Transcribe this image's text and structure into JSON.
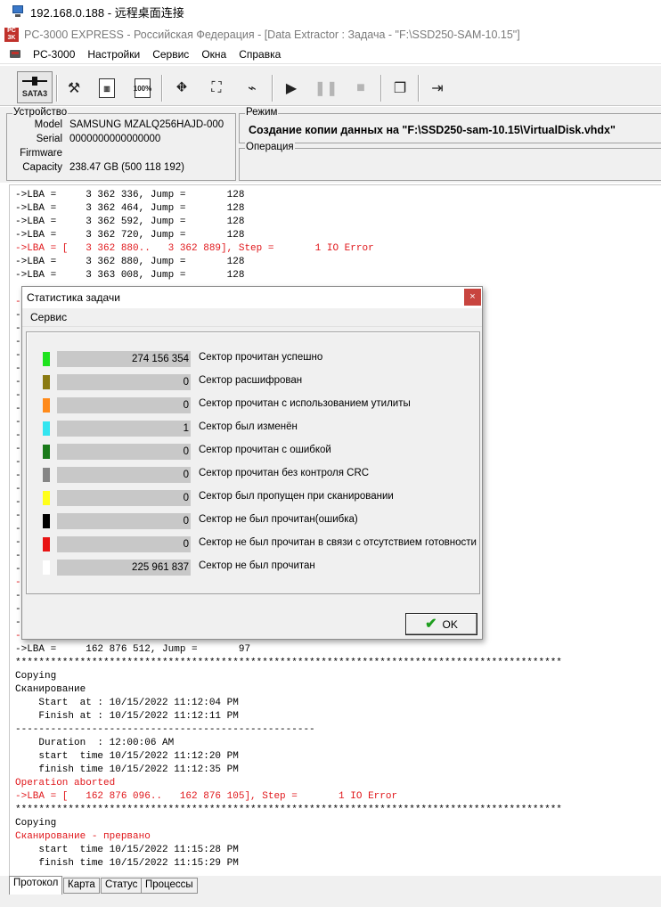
{
  "rdp": {
    "title": "192.168.0.188 - 远程桌面连接"
  },
  "app": {
    "logo": "PC 3K",
    "title": "PC-3000 EXPRESS - Российская Федерация - [Data Extractor : Задача - \"F:\\SSD250-SAM-10.15\"]"
  },
  "menu": {
    "items": [
      "PC-3000",
      "Настройки",
      "Сервис",
      "Окна",
      "Справка"
    ]
  },
  "toolbar": {
    "sata_label": "SATA3",
    "buttons": [
      {
        "name": "tools-icon",
        "glyph": "⚒"
      },
      {
        "name": "memory-icon",
        "glyph": "▥"
      },
      {
        "name": "percent-doc-icon",
        "glyph": "100%"
      },
      {
        "name": "pipe-icon",
        "glyph": "⛖"
      },
      {
        "name": "binoculars-icon",
        "glyph": "⛶"
      },
      {
        "name": "map-icon",
        "glyph": "⌁"
      },
      {
        "name": "play-icon",
        "glyph": "▶"
      },
      {
        "name": "pause-icon",
        "glyph": "❚❚"
      },
      {
        "name": "stop-icon",
        "glyph": "■"
      },
      {
        "name": "windows-icon",
        "glyph": "❐"
      },
      {
        "name": "exit-icon",
        "glyph": "⇥"
      }
    ]
  },
  "device": {
    "group_title": "Устройство",
    "rows": [
      {
        "key": "Model",
        "value": "SAMSUNG MZALQ256HAJD-000"
      },
      {
        "key": "Serial",
        "value": "0000000000000000"
      },
      {
        "key": "Firmware",
        "value": ""
      },
      {
        "key": "Capacity",
        "value": "238.47 GB (500 118 192)"
      }
    ]
  },
  "mode": {
    "group_title": "Режим",
    "text": "Создание копии данных на \"F:\\SSD250-sam-10.15\\VirtualDisk.vhdx\"",
    "operation_title": "Операция"
  },
  "log": {
    "lines": [
      {
        "t": "->LBA =     3 362 336, Jump =       128",
        "c": "black"
      },
      {
        "t": "->LBA =     3 362 464, Jump =       128",
        "c": "black"
      },
      {
        "t": "->LBA =     3 362 592, Jump =       128",
        "c": "black"
      },
      {
        "t": "->LBA =     3 362 720, Jump =       128",
        "c": "black"
      },
      {
        "t": "->LBA = [   3 362 880..   3 362 889], Step =       1 IO Error",
        "c": "red"
      },
      {
        "t": "->LBA =     3 362 880, Jump =       128",
        "c": "black"
      },
      {
        "t": "->LBA =     3 363 008, Jump =       128",
        "c": "black"
      }
    ],
    "lines_bottom": [
      {
        "t": "->LBA =     162 876 512, Jump =       97",
        "c": "black"
      },
      {
        "t": "*********************************************************************************************",
        "c": "black"
      },
      {
        "t": "Copying",
        "c": "black"
      },
      {
        "t": "Сканирование",
        "c": "black"
      },
      {
        "t": "    Start  at : 10/15/2022 11:12:04 PM",
        "c": "black"
      },
      {
        "t": "    Finish at : 10/15/2022 11:12:11 PM",
        "c": "black"
      },
      {
        "t": "---------------------------------------------------",
        "c": "black"
      },
      {
        "t": "    Duration  : 12:00:06 AM",
        "c": "black"
      },
      {
        "t": "    start  time 10/15/2022 11:12:20 PM",
        "c": "black"
      },
      {
        "t": "    finish time 10/15/2022 11:12:35 PM",
        "c": "black"
      },
      {
        "t": "Operation aborted",
        "c": "red"
      },
      {
        "t": "->LBA = [   162 876 096..   162 876 105], Step =       1 IO Error",
        "c": "red"
      },
      {
        "t": "*********************************************************************************************",
        "c": "black"
      },
      {
        "t": "Copying",
        "c": "black"
      },
      {
        "t": "Сканирование - прервано",
        "c": "red"
      },
      {
        "t": "    start  time 10/15/2022 11:15:28 PM",
        "c": "black"
      },
      {
        "t": "    finish time 10/15/2022 11:15:29 PM",
        "c": "black"
      }
    ],
    "hidden_markers": [
      "-",
      "-",
      "-",
      "-",
      "-",
      "-",
      "-",
      "-",
      "-",
      "-",
      "-",
      "-",
      "-",
      "-",
      "-",
      "-",
      "-",
      "-",
      "-",
      "-",
      "-",
      "-",
      "-",
      "-",
      "-",
      "-"
    ]
  },
  "tabs": [
    "Протокол",
    "Карта",
    "Статус",
    "Процессы"
  ],
  "dialog": {
    "title": "Статистика задачи",
    "close": "×",
    "menu": "Сервис",
    "ok_label": "OK",
    "stats": [
      {
        "color": "#1ee31e",
        "value": "274 156 354",
        "label": "Сектор прочитан успешно"
      },
      {
        "color": "#8a7a12",
        "value": "0",
        "label": "Сектор расшифрован"
      },
      {
        "color": "#ff8a1a",
        "value": "0",
        "label": "Сектор прочитан с использованием утилиты"
      },
      {
        "color": "#33e5f0",
        "value": "1",
        "label": "Сектор был изменён"
      },
      {
        "color": "#1a7a1a",
        "value": "0",
        "label": "Сектор прочитан с ошибкой"
      },
      {
        "color": "#858585",
        "value": "0",
        "label": "Сектор прочитан без контроля CRC"
      },
      {
        "color": "#ffff1a",
        "value": "0",
        "label": "Сектор был пропущен при сканировании"
      },
      {
        "color": "#000000",
        "value": "0",
        "label": "Сектор не был прочитан(ошибка)"
      },
      {
        "color": "#e81414",
        "value": "0",
        "label": "Сектор не был прочитан в связи с отсутствием готовности"
      },
      {
        "color": "#ffffff",
        "value": "225 961 837",
        "label": "Сектор не был прочитан"
      }
    ]
  }
}
